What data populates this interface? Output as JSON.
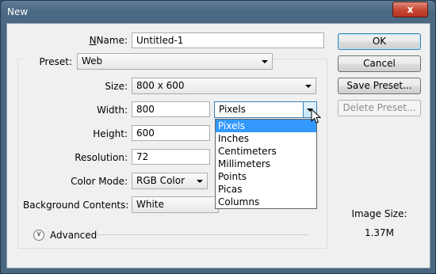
{
  "window": {
    "title": "New",
    "close_label": "x"
  },
  "form": {
    "name_label": "Name:",
    "name_value": "Untitled-1",
    "preset_label": "Preset:",
    "preset_value": "Web",
    "size_label": "Size:",
    "size_value": "800 x 600",
    "width_label": "Width:",
    "width_value": "800",
    "height_label": "Height:",
    "height_value": "600",
    "resolution_label": "Resolution:",
    "resolution_value": "72",
    "color_mode_label": "Color Mode:",
    "color_mode_value": "RGB Color",
    "background_label": "Background Contents:",
    "background_value": "White",
    "advanced_label": "Advanced",
    "unit_selected": "Pixels",
    "unit_options": [
      "Pixels",
      "Inches",
      "Centimeters",
      "Millimeters",
      "Points",
      "Picas",
      "Columns"
    ]
  },
  "buttons": {
    "ok": "OK",
    "cancel": "Cancel",
    "save_preset": "Save Preset...",
    "delete_preset": "Delete Preset..."
  },
  "image_size": {
    "label": "Image Size:",
    "value": "1.37M"
  },
  "colors": {
    "titlebar": "#4b6882",
    "selection": "#3399ff",
    "close": "#c74a34"
  }
}
